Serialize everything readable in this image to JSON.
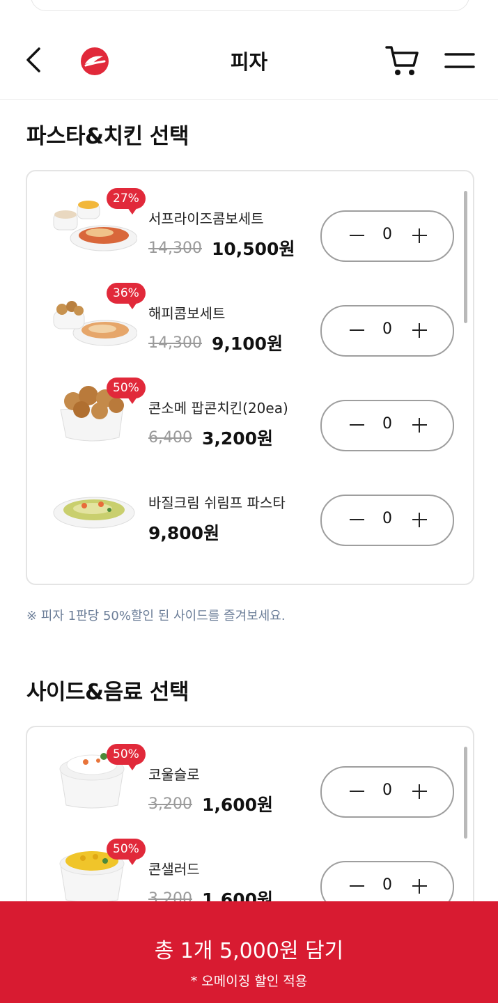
{
  "header": {
    "title": "피자"
  },
  "sections": [
    {
      "title": "파스타&치킨 선택",
      "items": [
        {
          "name": "서프라이즈콤보세트",
          "badge": "27%",
          "old_price": "14,300",
          "price": "10,500원",
          "qty": "0",
          "image": "pasta-combo"
        },
        {
          "name": "해피콤보세트",
          "badge": "36%",
          "old_price": "14,300",
          "price": "9,100원",
          "qty": "0",
          "image": "chicken-pasta-combo"
        },
        {
          "name": "콘소메 팝콘치킨(20ea)",
          "badge": "50%",
          "old_price": "6,400",
          "price": "3,200원",
          "qty": "0",
          "image": "popcorn-chicken"
        },
        {
          "name": "바질크림 쉬림프 파스타",
          "badge": "",
          "old_price": "",
          "price": "9,800원",
          "qty": "0",
          "image": "basil-pasta"
        }
      ]
    },
    {
      "title": "사이드&음료 선택",
      "items": [
        {
          "name": "코울슬로",
          "badge": "50%",
          "old_price": "3,200",
          "price": "1,600원",
          "qty": "0",
          "image": "coleslaw"
        },
        {
          "name": "콘샐러드",
          "badge": "50%",
          "old_price": "3,200",
          "price": "1,600원",
          "qty": "0",
          "image": "corn-salad"
        }
      ]
    }
  ],
  "notice": "※ 피자 1판당 50%할인 된 사이드를 즐겨보세요.",
  "bottom_bar": {
    "main": "총 1개 5,000원 담기",
    "sub": "* 오메이징 할인 적용"
  },
  "colors": {
    "brand": "#d81b31",
    "badge": "#e1293a",
    "notice": "#6d7f99"
  }
}
